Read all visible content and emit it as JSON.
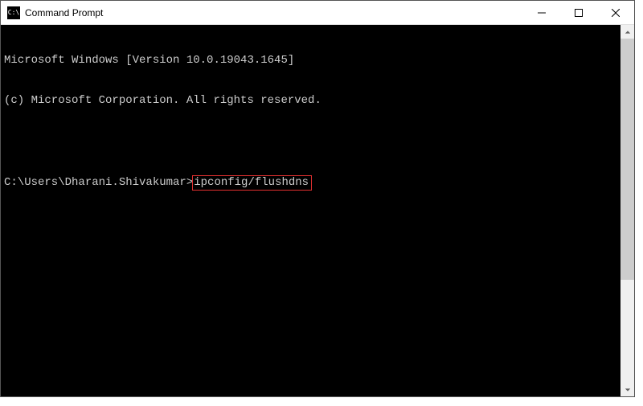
{
  "window": {
    "title": "Command Prompt"
  },
  "console": {
    "line1": "Microsoft Windows [Version 10.0.19043.1645]",
    "line2": "(c) Microsoft Corporation. All rights reserved.",
    "prompt": "C:\\Users\\Dharani.Shivakumar>",
    "command": "ipconfig/flushdns"
  }
}
